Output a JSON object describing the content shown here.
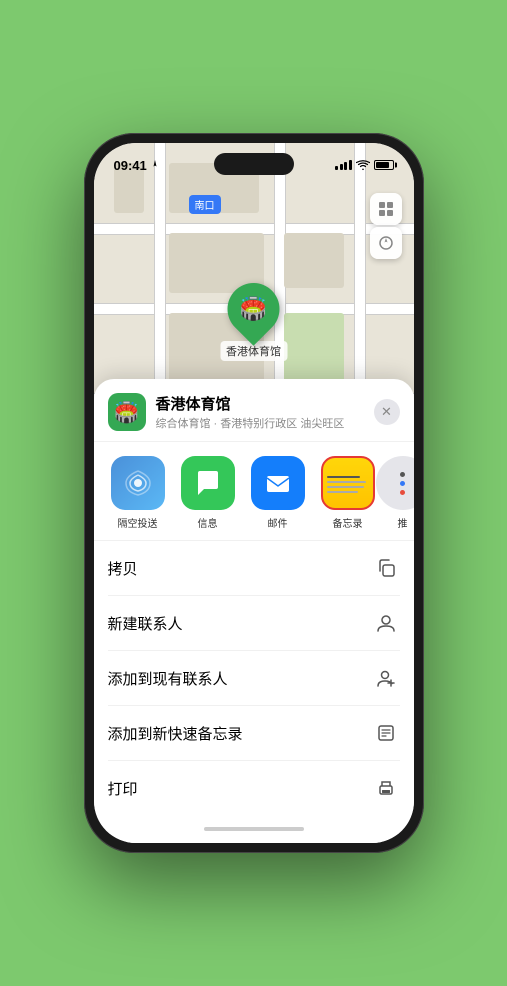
{
  "status_bar": {
    "time": "09:41",
    "location_arrow": "▶"
  },
  "map": {
    "label": "南口",
    "stadium_name": "香港体育馆"
  },
  "venue": {
    "name": "香港体育馆",
    "subtitle": "综合体育馆 · 香港特别行政区 油尖旺区",
    "icon_emoji": "🏟️"
  },
  "share_items": [
    {
      "id": "airdrop",
      "label": "隔空投送"
    },
    {
      "id": "messages",
      "label": "信息"
    },
    {
      "id": "mail",
      "label": "邮件"
    },
    {
      "id": "notes",
      "label": "备忘录"
    },
    {
      "id": "more",
      "label": "推"
    }
  ],
  "actions": [
    {
      "label": "拷贝",
      "icon": "copy"
    },
    {
      "label": "新建联系人",
      "icon": "person"
    },
    {
      "label": "添加到现有联系人",
      "icon": "person-add"
    },
    {
      "label": "添加到新快速备忘录",
      "icon": "note"
    },
    {
      "label": "打印",
      "icon": "print"
    }
  ],
  "close_btn": "✕"
}
